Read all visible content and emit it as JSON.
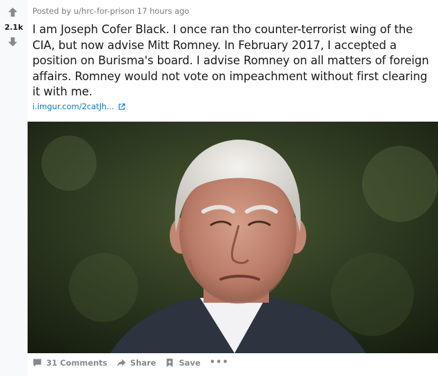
{
  "vote": {
    "count": "2.1k"
  },
  "post": {
    "posted_by_prefix": "Posted by ",
    "author": "u/hrc-for-prison",
    "time": " 17 hours ago",
    "title": "I am Joseph Cofer Black. I once ran tho counter-terrorist wing of the CIA, but now advise Mitt Romney. In February 2017, I accepted a position on Burisma's board. I advise Romney on all matters of foreign affairs. Romney would not vote on impeachment without first clearing it with me.",
    "link_text": "i.imgur.com/2catJh..."
  },
  "actions": {
    "comments": "31 Comments",
    "share": "Share",
    "save": "Save",
    "more": "•••"
  },
  "colors": {
    "link": "#0079d3",
    "meta": "#787c7e",
    "action": "#878a8c",
    "vote_bg": "#f8f9fa"
  },
  "icons": [
    "upvote-icon",
    "downvote-icon",
    "external-link-icon",
    "comment-icon",
    "share-icon",
    "save-icon"
  ]
}
